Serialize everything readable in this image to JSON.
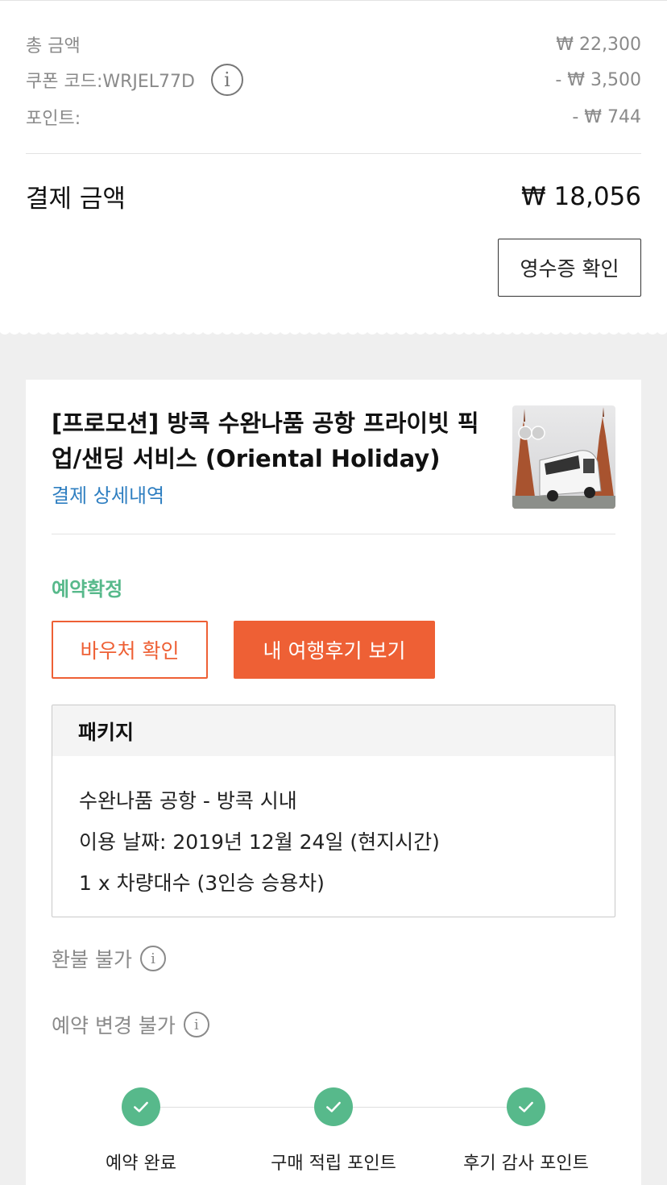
{
  "summary": {
    "total_label": "총 금액",
    "total_value": "₩ 22,300",
    "coupon_label": "쿠폰 코드:WRJEL77D",
    "coupon_value": "- ₩ 3,500",
    "points_label": "포인트:",
    "points_value": "- ₩ 744",
    "payment_label": "결제 금액",
    "payment_value": "₩ 18,056",
    "receipt_button": "영수증 확인"
  },
  "product": {
    "title_line1": "[프로모션] 방콕 수완나품 공항 프라이빗 픽",
    "title_line2": "업/샌딩 서비스 (Oriental Holiday)",
    "detail_link": "결제 상세내역",
    "status": "예약확정",
    "voucher_button": "바우처 확인",
    "review_button": "내 여행후기 보기"
  },
  "package": {
    "header": "패키지",
    "lines": [
      "수완나품 공항 - 방콕 시내",
      "이용 날짜: 2019년 12월 24일 (현지시간)",
      "1 x 차량대수 (3인승 승용차)"
    ]
  },
  "policies": {
    "refund": "환불 불가",
    "change": "예약 변경 불가"
  },
  "steps": [
    "예약 완료",
    "구매 적립 포인트",
    "후기 감사 포인트"
  ],
  "colors": {
    "accent_orange": "#ee6035",
    "status_green": "#57b98b",
    "link_blue": "#2f7fc1"
  }
}
